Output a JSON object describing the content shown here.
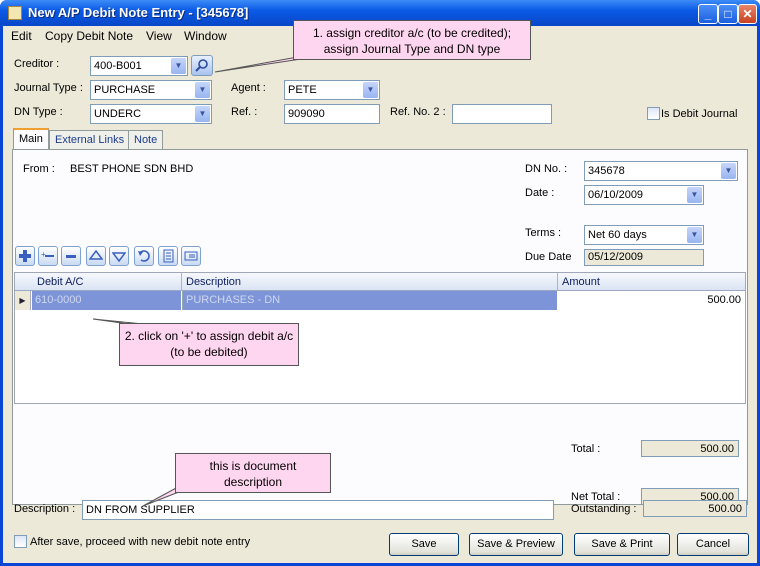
{
  "window": {
    "title": "New A/P Debit Note Entry - [345678]",
    "min": "_",
    "max": "□",
    "close": "✕"
  },
  "menu": [
    "Edit",
    "Copy Debit Note",
    "View",
    "Window"
  ],
  "header": {
    "creditor_label": "Creditor :",
    "creditor_value": "400-B001",
    "journal_type_label": "Journal Type :",
    "journal_type_value": "PURCHASE",
    "dn_type_label": "DN Type :",
    "dn_type_value": "UNDERC",
    "agent_label": "Agent :",
    "agent_value": "PETE",
    "ref_label": "Ref. :",
    "ref_value": "909090",
    "ref2_label": "Ref. No. 2 :",
    "ref2_value": "",
    "is_debit_journal_label": "Is Debit Journal"
  },
  "tabs": [
    "Main",
    "External Links",
    "Note"
  ],
  "main": {
    "from_label": "From :",
    "from_value": "BEST PHONE SDN BHD",
    "dn_no_label": "DN No. :",
    "dn_no_value": "345678",
    "date_label": "Date :",
    "date_value": "06/10/2009",
    "terms_label": "Terms :",
    "terms_value": "Net 60 days",
    "due_date_label": "Due Date",
    "due_date_value": "05/12/2009"
  },
  "grid": {
    "columns": [
      "Debit A/C",
      "Description",
      "Amount"
    ],
    "rows": [
      {
        "debit_ac": "610-0000",
        "description": "PURCHASES - DN",
        "amount": "500.00"
      }
    ]
  },
  "totals": {
    "total_label": "Total :",
    "total_value": "500.00",
    "net_total_label": "Net Total :",
    "net_total_value": "500.00",
    "outstanding_label": "Outstanding :",
    "outstanding_value": "500.00"
  },
  "footer": {
    "description_label": "Description :",
    "description_value": "DN FROM SUPPLIER",
    "after_save_label": "After save, proceed with new debit note entry",
    "save": "Save",
    "save_preview": "Save & Preview",
    "save_print": "Save & Print",
    "cancel": "Cancel"
  },
  "callouts": {
    "c1": "1. assign creditor a/c (to be credited); assign Journal Type and DN type",
    "c2": "2. click on '+' to assign debit a/c (to be debited)",
    "c3": "this is document description"
  }
}
